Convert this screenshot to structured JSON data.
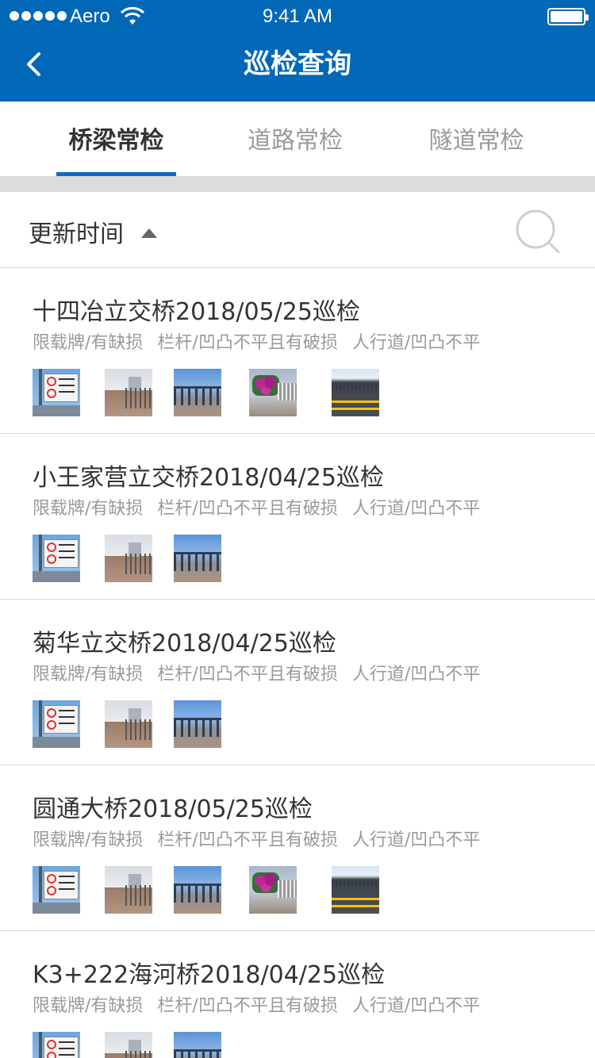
{
  "status_bar": {
    "carrier": "Aero",
    "time": "9:41 AM"
  },
  "nav": {
    "title": "巡检查询"
  },
  "tabs": [
    {
      "label": "桥梁常检",
      "active": true
    },
    {
      "label": "道路常检",
      "active": false
    },
    {
      "label": "隧道常检",
      "active": false
    }
  ],
  "sort": {
    "label": "更新时间"
  },
  "items": [
    {
      "title": "十四冶立交桥2018/05/25巡检",
      "tags": [
        "限载牌/有缺损",
        "栏杆/凹凸不平且有破损",
        "人行道/凹凸不平"
      ],
      "photos": [
        "sign",
        "walkway",
        "railing",
        "flowers",
        "road"
      ]
    },
    {
      "title": "小王家营立交桥2018/04/25巡检",
      "tags": [
        "限载牌/有缺损",
        "栏杆/凹凸不平且有破损",
        "人行道/凹凸不平"
      ],
      "photos": [
        "sign",
        "walkway",
        "railing"
      ]
    },
    {
      "title": "菊华立交桥2018/04/25巡检",
      "tags": [
        "限载牌/有缺损",
        "栏杆/凹凸不平且有破损",
        "人行道/凹凸不平"
      ],
      "photos": [
        "sign",
        "walkway",
        "railing"
      ]
    },
    {
      "title": "圆通大桥2018/05/25巡检",
      "tags": [
        "限载牌/有缺损",
        "栏杆/凹凸不平且有破损",
        "人行道/凹凸不平"
      ],
      "photos": [
        "sign",
        "walkway",
        "railing",
        "flowers",
        "road"
      ]
    },
    {
      "title": "K3+222海河桥2018/04/25巡检",
      "tags": [
        "限载牌/有缺损",
        "栏杆/凹凸不平且有破损",
        "人行道/凹凸不平"
      ],
      "photos": [
        "sign",
        "walkway",
        "railing"
      ]
    }
  ],
  "colors": {
    "brand": "#0168b7",
    "tab_indicator": "#0b6cc7",
    "muted_text": "#9a9a9a"
  }
}
